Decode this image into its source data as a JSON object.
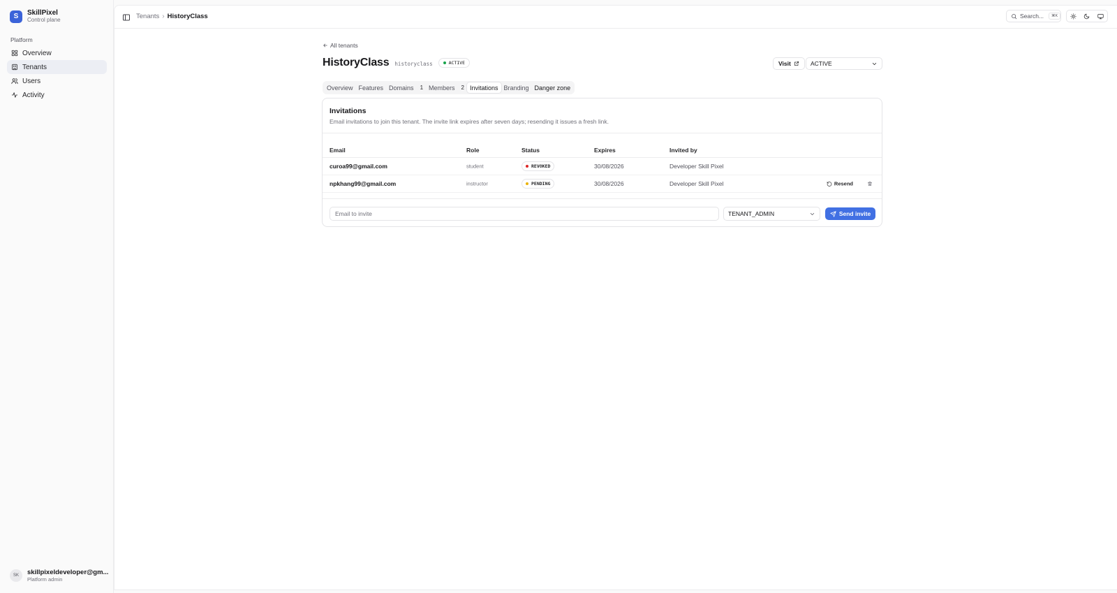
{
  "brand": {
    "logo_letter": "S",
    "name": "SkillPixel",
    "subtitle": "Control plane"
  },
  "sidebar": {
    "group_label": "Platform",
    "items": [
      {
        "label": "Overview",
        "icon": "layout-grid-icon",
        "active": false
      },
      {
        "label": "Tenants",
        "icon": "building-icon",
        "active": true
      },
      {
        "label": "Users",
        "icon": "users-icon",
        "active": false
      },
      {
        "label": "Activity",
        "icon": "activity-icon",
        "active": false
      }
    ],
    "user": {
      "initials": "SK",
      "email": "skillpixeldeveloper@gm...",
      "role": "Platform admin"
    }
  },
  "topbar": {
    "breadcrumb": {
      "parent": "Tenants",
      "current": "HistoryClass"
    },
    "search": {
      "label": "Search...",
      "shortcut": "⌘K"
    }
  },
  "page": {
    "back_label": "All tenants",
    "title": "HistoryClass",
    "slug": "historyclass",
    "status_badge": "ACTIVE",
    "visit_label": "Visit",
    "status_select_value": "ACTIVE",
    "tabs": [
      {
        "label": "Overview",
        "count": ""
      },
      {
        "label": "Features",
        "count": ""
      },
      {
        "label": "Domains",
        "count": "1"
      },
      {
        "label": "Members",
        "count": "2"
      },
      {
        "label": "Invitations",
        "count": "",
        "active": true
      },
      {
        "label": "Branding",
        "count": ""
      },
      {
        "label": "Danger zone",
        "count": ""
      }
    ]
  },
  "invitations": {
    "title": "Invitations",
    "description": "Email invitations to join this tenant. The invite link expires after seven days; resending it issues a fresh link.",
    "columns": {
      "email": "Email",
      "role": "Role",
      "status": "Status",
      "expires": "Expires",
      "invited_by": "Invited by"
    },
    "rows": [
      {
        "email": "curoa99@gmail.com",
        "role": "student",
        "status": "REVOKED",
        "status_color": "#dc2626",
        "expires": "30/08/2026",
        "invited_by": "Developer Skill Pixel",
        "resend": ""
      },
      {
        "email": "npkhang99@gmail.com",
        "role": "instructor",
        "status": "PENDING",
        "status_color": "#eab308",
        "expires": "30/08/2026",
        "invited_by": "Developer Skill Pixel",
        "resend": "Resend"
      }
    ],
    "invite_form": {
      "email_placeholder": "Email to invite",
      "role_value": "TENANT_ADMIN",
      "send_label": "Send invite"
    }
  },
  "colors": {
    "accent": "#4170e3",
    "brand": "#3b63d9",
    "active_dot": "#16a34a"
  }
}
